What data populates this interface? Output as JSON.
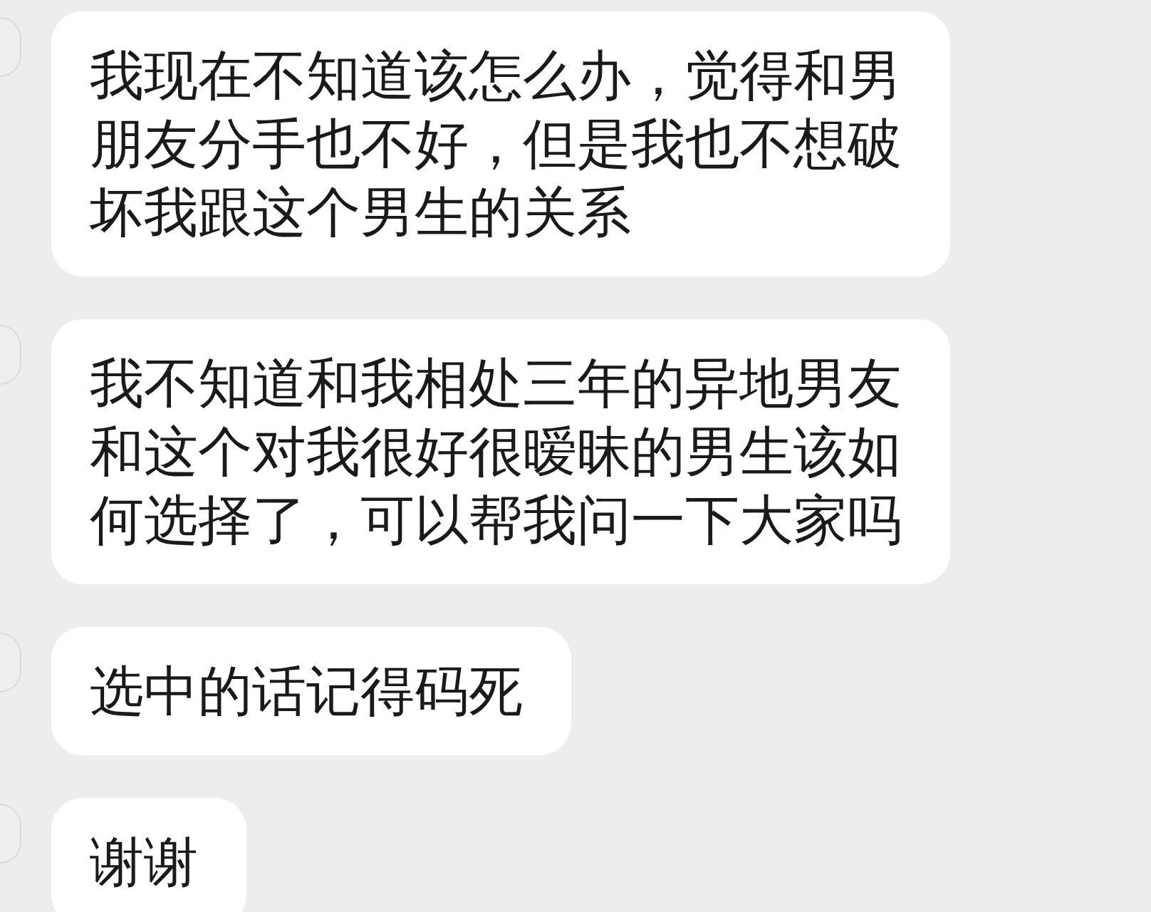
{
  "messages": [
    {
      "text": "我现在不知道该怎么办，觉得和男朋友分手也不好，但是我也不想破坏我跟这个男生的关系"
    },
    {
      "text": "我不知道和我相处三年的异地男友和这个对我很好很暧昧的男生该如何选择了，可以帮我问一下大家吗"
    },
    {
      "text": "选中的话记得码死"
    },
    {
      "text": "谢谢"
    }
  ]
}
